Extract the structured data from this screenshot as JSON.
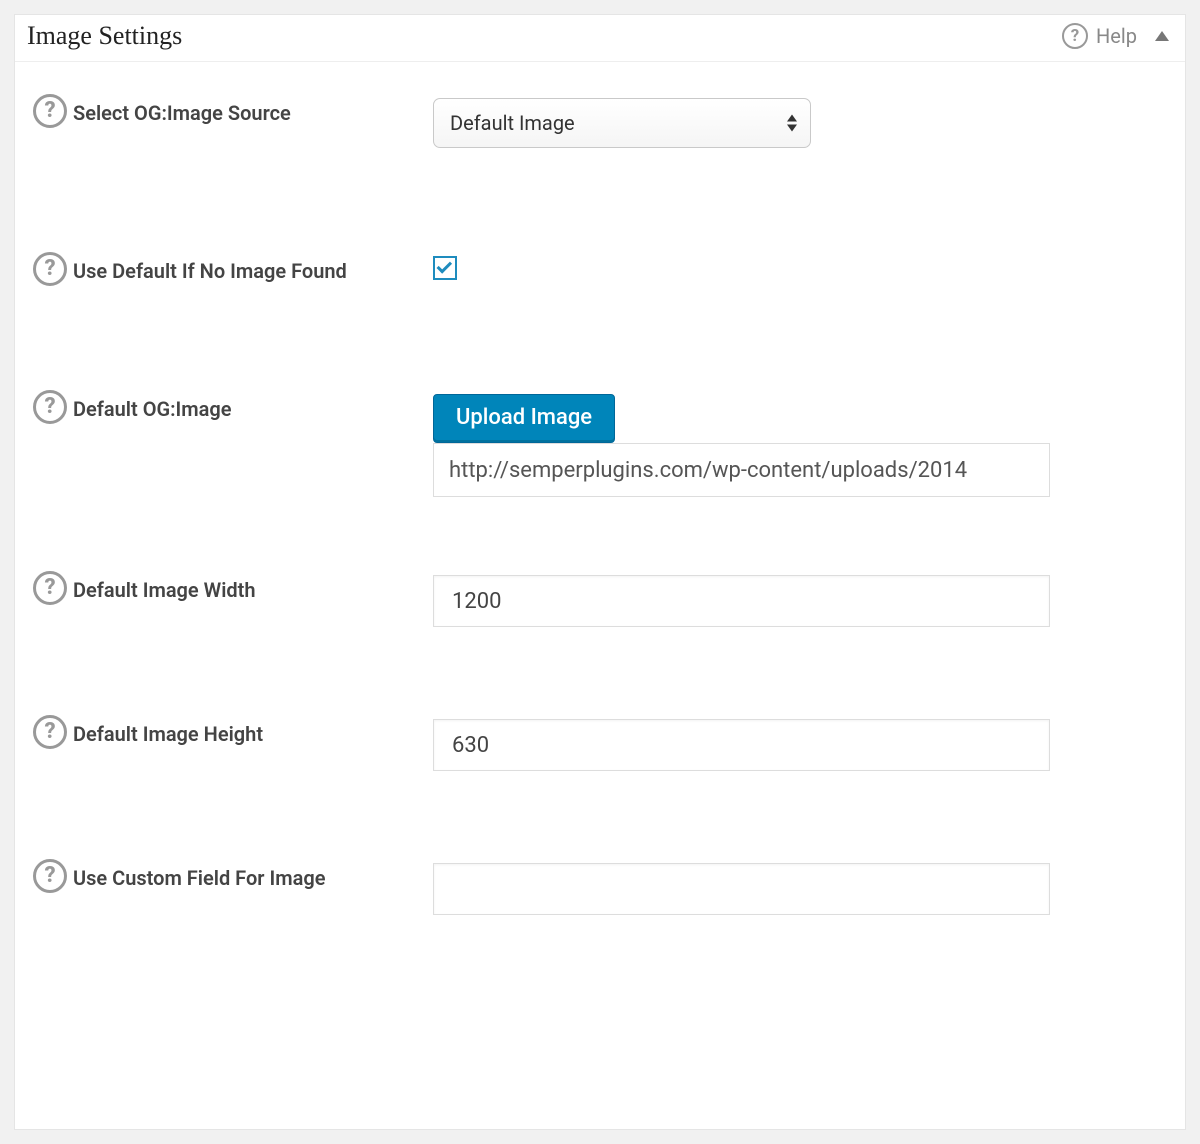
{
  "panel": {
    "title": "Image Settings",
    "help_label": "Help"
  },
  "fields": {
    "select_og_image_source": {
      "label": "Select OG:Image Source",
      "value": "Default Image"
    },
    "use_default_if_none": {
      "label": "Use Default If No Image Found",
      "checked": true
    },
    "default_og_image": {
      "label": "Default OG:Image",
      "button": "Upload Image",
      "value": "http://semperplugins.com/wp-content/uploads/2014"
    },
    "default_image_width": {
      "label": "Default Image Width",
      "value": "1200"
    },
    "default_image_height": {
      "label": "Default Image Height",
      "value": "630"
    },
    "custom_field": {
      "label": "Use Custom Field For Image",
      "value": ""
    }
  }
}
